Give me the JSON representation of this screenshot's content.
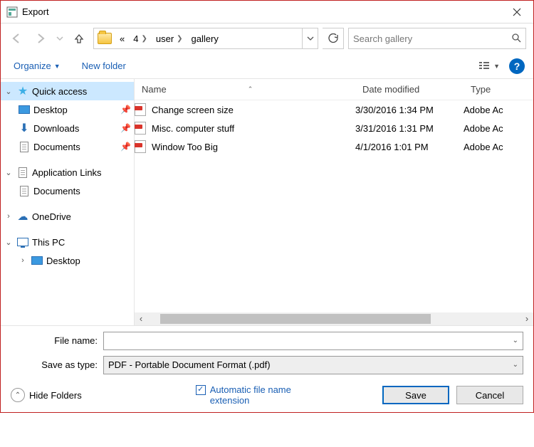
{
  "window": {
    "title": "Export"
  },
  "nav": {
    "crumbs": [
      "«",
      "4",
      "user",
      "gallery"
    ],
    "search_placeholder": "Search gallery"
  },
  "toolbar": {
    "organize": "Organize",
    "newfolder": "New folder"
  },
  "tree": {
    "quick_access": "Quick access",
    "desktop": "Desktop",
    "downloads": "Downloads",
    "documents": "Documents",
    "app_links": "Application Links",
    "app_links_documents": "Documents",
    "onedrive": "OneDrive",
    "this_pc": "This PC",
    "this_pc_desktop": "Desktop"
  },
  "columns": {
    "name": "Name",
    "date": "Date modified",
    "type": "Type"
  },
  "files": [
    {
      "name": "Change screen size",
      "date": "3/30/2016 1:34 PM",
      "type": "Adobe Ac"
    },
    {
      "name": "Misc. computer stuff",
      "date": "3/31/2016 1:31 PM",
      "type": "Adobe Ac"
    },
    {
      "name": "Window Too Big",
      "date": "4/1/2016 1:01 PM",
      "type": "Adobe Ac"
    }
  ],
  "form": {
    "filename_label": "File name:",
    "filename_value": "",
    "type_label": "Save as type:",
    "type_value": "PDF - Portable Document Format (.pdf)"
  },
  "footer": {
    "hide_folders": "Hide Folders",
    "auto_ext": "Automatic file name extension",
    "save": "Save",
    "cancel": "Cancel"
  }
}
